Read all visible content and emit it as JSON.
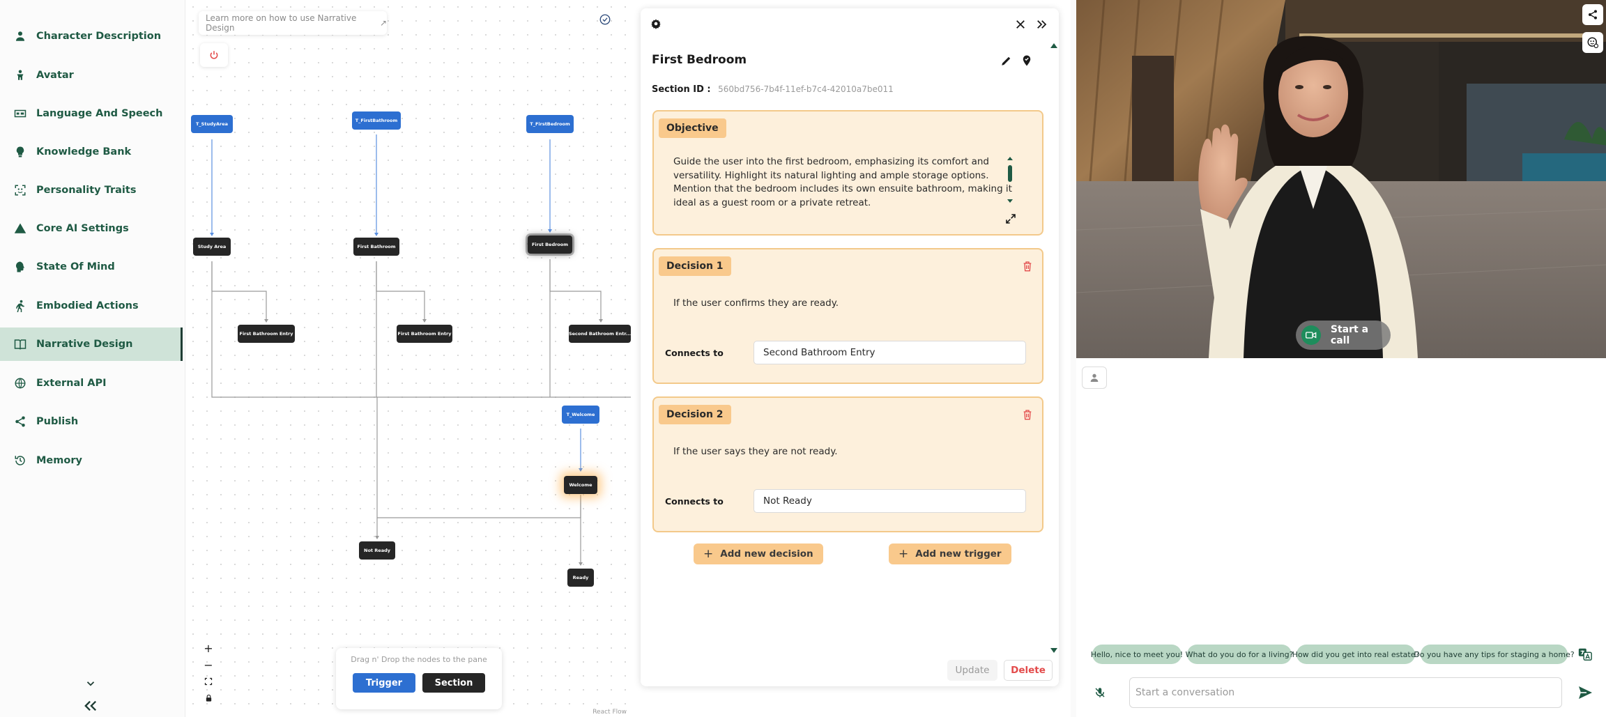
{
  "sidebar": {
    "items": [
      {
        "label": "Character Description",
        "icon": "person-icon"
      },
      {
        "label": "Avatar",
        "icon": "avatar-icon"
      },
      {
        "label": "Language And Speech",
        "icon": "speech-icon"
      },
      {
        "label": "Knowledge Bank",
        "icon": "lightbulb-icon"
      },
      {
        "label": "Personality Traits",
        "icon": "scan-face-icon"
      },
      {
        "label": "Core AI Settings",
        "icon": "warning-triangle-icon"
      },
      {
        "label": "State Of Mind",
        "icon": "head-icon"
      },
      {
        "label": "Embodied Actions",
        "icon": "running-person-icon"
      },
      {
        "label": "Narrative Design",
        "icon": "book-icon"
      },
      {
        "label": "External API",
        "icon": "globe-icon"
      },
      {
        "label": "Publish",
        "icon": "share-icon"
      },
      {
        "label": "Memory",
        "icon": "history-icon"
      }
    ],
    "active": "Narrative Design"
  },
  "canvas": {
    "learn_more": "Learn more on how to use Narrative Design",
    "nodes": {
      "t_study": "T_StudyArea",
      "t_firstbath": "T_FirstBathroom",
      "t_firstbed": "T_FirstBedroom",
      "study": "Study Area",
      "firstbath": "First Bathroom",
      "firstbed": "First Bedroom",
      "fb_entry1": "First Bathroom Entry",
      "fb_entry2": "First Bathroom Entry",
      "sb_entry": "Second Bathroom Entr...",
      "t_welcome": "T_Welcome",
      "welcome": "Welcome",
      "not_ready": "Not Ready",
      "ready": "Ready"
    },
    "drag_hint": "Drag n' Drop the nodes to the pane",
    "trigger_label": "Trigger",
    "section_label": "Section",
    "attribution": "React Flow"
  },
  "panel": {
    "title": "First Bedroom",
    "section_id_label": "Section ID :",
    "section_id": "560bd756-7b4f-11ef-b7c4-42010a7be011",
    "objective": {
      "label": "Objective",
      "lines": [
        "Guide the user into the first bedroom, emphasizing its comfort and",
        "versatility. Highlight its natural lighting and ample storage options.",
        "Mention that the bedroom includes its own ensuite bathroom, making it",
        "ideal as a guest room or a private retreat."
      ]
    },
    "decisions": [
      {
        "label": "Decision 1",
        "text": "If the user confirms they are ready.",
        "connects_label": "Connects to",
        "connects_to": "Second Bathroom Entry"
      },
      {
        "label": "Decision 2",
        "text": "If the user says they are not ready.",
        "connects_label": "Connects to",
        "connects_to": "Not Ready"
      }
    ],
    "add_decision": "Add new decision",
    "add_trigger": "Add new trigger",
    "update": "Update",
    "delete": "Delete"
  },
  "chat": {
    "start_call": "Start a call",
    "suggestions": [
      "Hello, nice to meet you!",
      "What do you do for a living?",
      "How did you get into real estate?",
      "Do you have any tips for staging a home?"
    ],
    "input_placeholder": "Start a conversation"
  },
  "colors": {
    "accent": "#1f5a44",
    "trigger_node": "#2d6fd1",
    "section_node": "#262626",
    "card_bg": "#fdf0dc",
    "card_border": "#f3c98a",
    "danger": "#e34b4b"
  }
}
